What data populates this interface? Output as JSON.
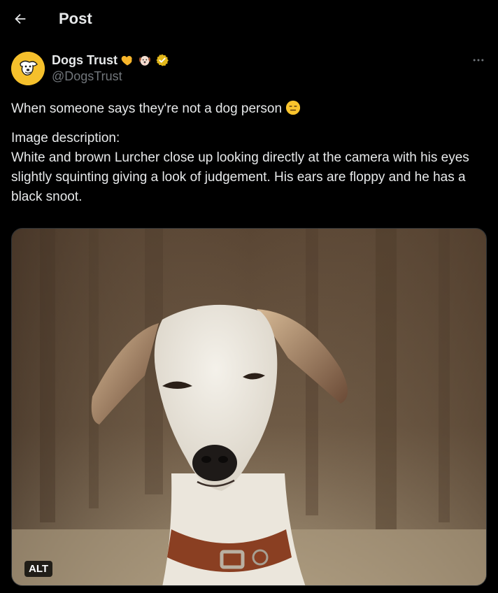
{
  "header": {
    "title": "Post",
    "back_icon": "arrow-left-icon"
  },
  "post": {
    "author": {
      "display_name": "Dogs Trust",
      "handle": "@DogsTrust",
      "name_emojis": [
        "yellow-heart-icon",
        "dog-face-icon",
        "verified-badge-icon"
      ],
      "avatar_color": "#f5c02c"
    },
    "text_line_1": "When someone says they're not a dog person",
    "text_emoji": "expressionless-face-icon",
    "image_desc_label": "Image description:",
    "image_desc_body": "White and brown Lurcher close up looking directly at the camera with his eyes slightly squinting giving a look of judgement. His ears are floppy and he has a black snoot.",
    "media": {
      "alt_label": "ALT"
    }
  }
}
